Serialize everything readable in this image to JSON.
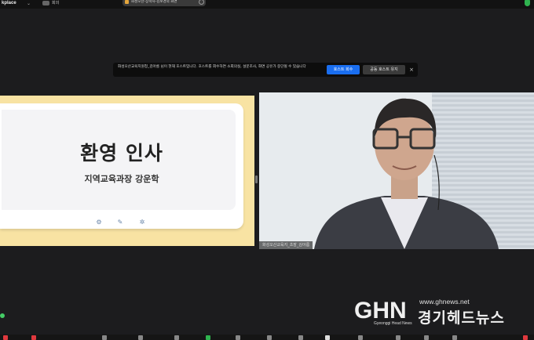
{
  "app": {
    "name": "kplace",
    "meeting_label": "회의",
    "window_title": "화성오산-장학사-김보경의 화면"
  },
  "banner": {
    "message": "화성오산교육지원청_김아름 님이 현재 호스트입니다. 호스트를 회수하면 소회의실, 설문조사, 화면 공유가 중단될 수 있습니다",
    "reclaim_label": "호스트 회수",
    "keep_label": "공동 호스트 유지",
    "close_glyph": "×"
  },
  "slide": {
    "title": "환영 인사",
    "subtitle": "지역교육과장 강운학"
  },
  "participant": {
    "name": "화성오산교육지_초장_김아름"
  },
  "watermark": {
    "logo_text": "GHN",
    "logo_sub": "Gyeonggi Head News",
    "url": "www.ghnews.net",
    "name": "경기헤드뉴스"
  },
  "colors": {
    "slide_frame": "#f8e3a3",
    "reclaim_button": "#1a6ef0",
    "security": "#2fb34f",
    "share_icon": "#2fb34f",
    "end_button": "#e0393e"
  },
  "icons": {
    "security": "shield-icon",
    "meeting": "video-icon",
    "share": "share-screen-icon",
    "end": "end-call-icon"
  }
}
